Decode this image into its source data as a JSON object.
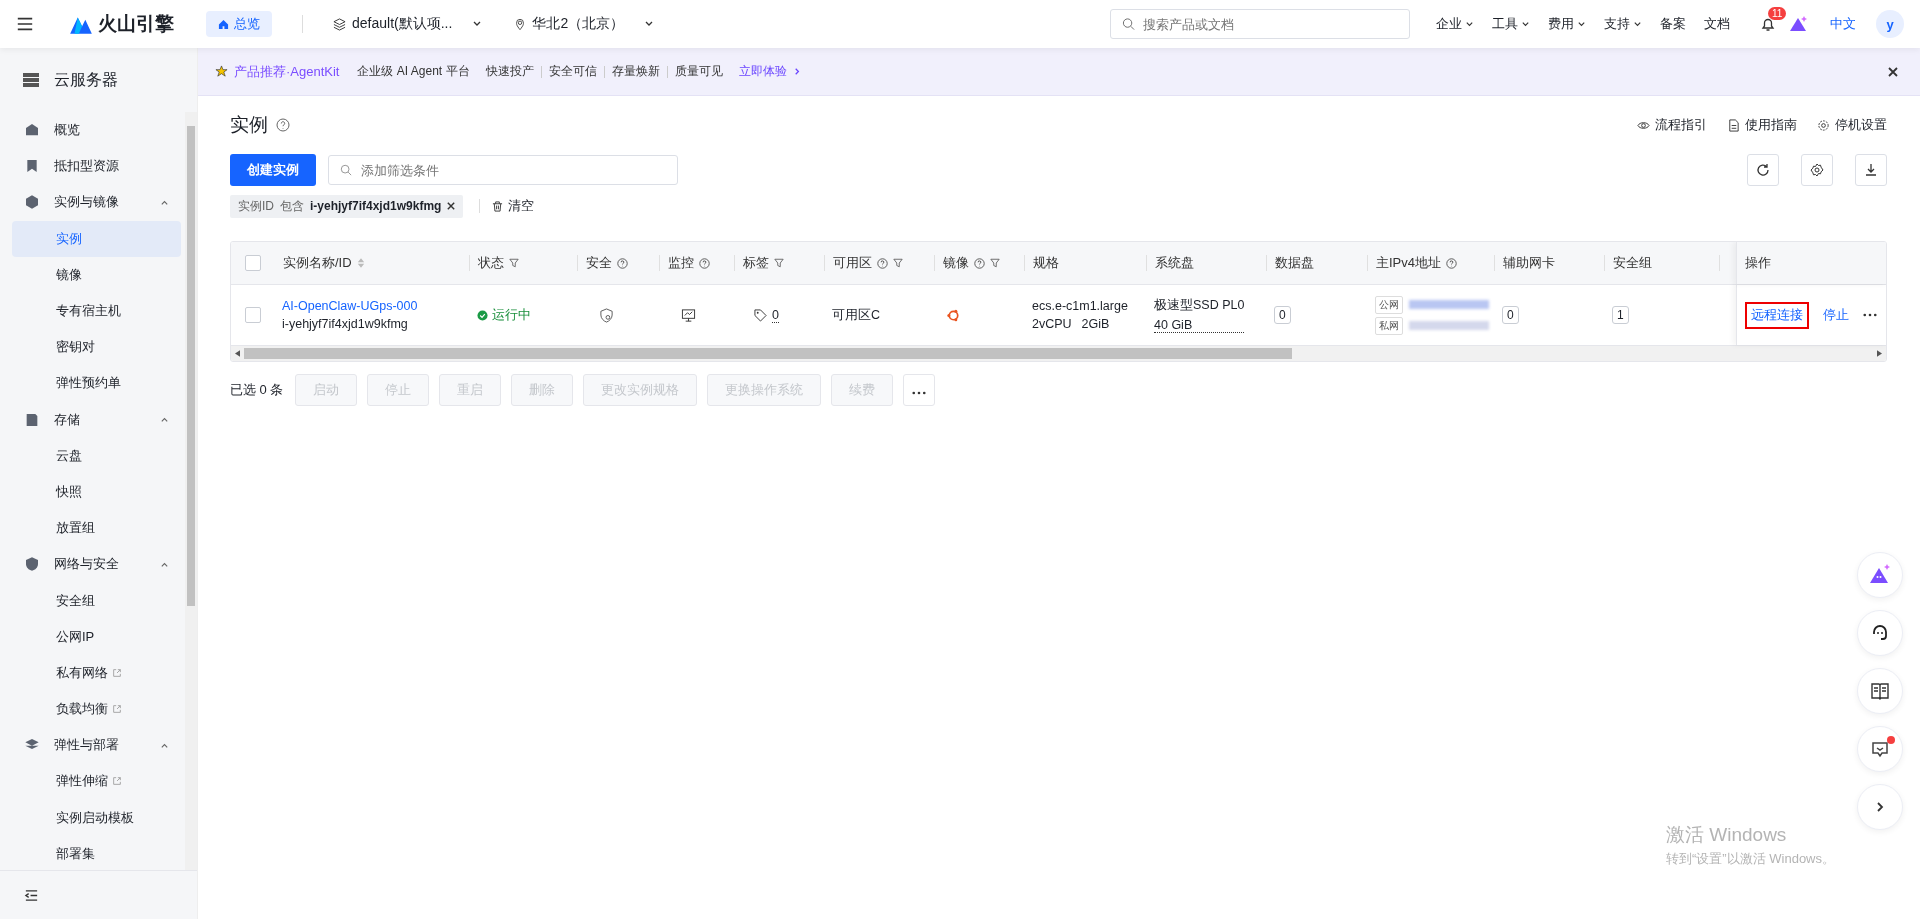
{
  "header": {
    "logo": "火山引擎",
    "home": {
      "label": "总览",
      "selected": true
    },
    "project": "default(默认项...",
    "region": "华北2（北京）",
    "search": {
      "placeholder": "搜索产品或文档"
    },
    "nav": [
      {
        "label": "企业",
        "dropdown": true
      },
      {
        "label": "工具",
        "dropdown": true
      },
      {
        "label": "费用",
        "dropdown": true
      },
      {
        "label": "支持",
        "dropdown": true
      },
      {
        "label": "备案"
      },
      {
        "label": "文档"
      }
    ],
    "notifications": "11",
    "language": "中文",
    "avatar": "y"
  },
  "sidebar": {
    "title": "云服务器",
    "items": [
      {
        "label": "概览"
      },
      {
        "label": "抵扣型资源"
      },
      {
        "label": "实例与镜像",
        "expanded": true,
        "children": [
          {
            "label": "实例",
            "selected": true
          },
          {
            "label": "镜像",
            "selected": false
          },
          {
            "label": "专有宿主机",
            "selected": false
          },
          {
            "label": "密钥对",
            "selected": false
          },
          {
            "label": "弹性预约单",
            "selected": false
          }
        ]
      },
      {
        "label": "存储",
        "expanded": true,
        "children": [
          {
            "label": "云盘",
            "selected": false
          },
          {
            "label": "快照",
            "selected": false
          },
          {
            "label": "放置组",
            "selected": false
          }
        ]
      },
      {
        "label": "网络与安全",
        "expanded": true,
        "children": [
          {
            "label": "安全组",
            "selected": false
          },
          {
            "label": "公网IP",
            "selected": false
          },
          {
            "label": "私有网络",
            "selected": false,
            "external": true
          },
          {
            "label": "负载均衡",
            "selected": false,
            "external": true
          }
        ]
      },
      {
        "label": "弹性与部署",
        "expanded": true,
        "children": [
          {
            "label": "弹性伸缩",
            "selected": false,
            "external": true
          },
          {
            "label": "实例启动模板",
            "selected": false
          },
          {
            "label": "部署集",
            "selected": false
          }
        ]
      }
    ]
  },
  "banner": {
    "title": "产品推荐·AgentKit",
    "subtitle": "企业级 AI Agent 平台",
    "features": [
      "快速投产",
      "安全可信",
      "存量焕新",
      "质量可见"
    ],
    "link": "立即体验"
  },
  "page": {
    "title": "实例",
    "links": [
      "流程指引",
      "使用指南",
      "停机设置"
    ],
    "create_button": "创建实例",
    "filter": {
      "placeholder": "添加筛选条件"
    },
    "filter_tag": {
      "key": "实例ID",
      "operator": "包含",
      "value": "i-yehjyf7if4xjd1w9kfmg"
    },
    "clear": "清空"
  },
  "table": {
    "select_all": {
      "checked": false
    },
    "columns": [
      {
        "label": "实例名称/ID",
        "sort": true
      },
      {
        "label": "状态",
        "filter": true
      },
      {
        "label": "安全",
        "help": true
      },
      {
        "label": "监控",
        "help": true
      },
      {
        "label": "标签",
        "filter": true
      },
      {
        "label": "可用区",
        "help": true,
        "filter": true
      },
      {
        "label": "镜像",
        "help": true,
        "filter": true
      },
      {
        "label": "规格"
      },
      {
        "label": "系统盘"
      },
      {
        "label": "数据盘"
      },
      {
        "label": "主IPv4地址",
        "help": true
      },
      {
        "label": "辅助网卡"
      },
      {
        "label": "安全组"
      }
    ],
    "actions_column": "操作",
    "rows": [
      {
        "checked": false,
        "name": "AI-OpenClaw-UGps-000",
        "id": "i-yehjyf7if4xjd1w9kfmg",
        "status": {
          "label": "运行中",
          "kind": "running"
        },
        "tags": "0",
        "zone": "可用区C",
        "spec": "ecs.e-c1m1.large",
        "cpu": "2vCPU",
        "memory": "2GiB",
        "system_disk": "极速型SSD PL0",
        "system_disk_size": "40 GiB",
        "data_disks": "0",
        "ip_labels": [
          "公网",
          "私网"
        ],
        "aux_nics": "0",
        "security_groups": "1",
        "actions": [
          {
            "label": "远程连接",
            "highlighted": true
          },
          {
            "label": "停止",
            "highlighted": false
          }
        ]
      }
    ]
  },
  "footer": {
    "selected_count": "已选 0 条",
    "buttons": [
      {
        "label": "启动",
        "disabled": true
      },
      {
        "label": "停止",
        "disabled": true
      },
      {
        "label": "重启",
        "disabled": true
      },
      {
        "label": "删除",
        "disabled": true
      },
      {
        "label": "更改实例规格",
        "disabled": true
      },
      {
        "label": "更换操作系统",
        "disabled": true
      },
      {
        "label": "续费",
        "disabled": true
      }
    ]
  },
  "floating": [
    {
      "kind": "ai",
      "dot": false
    },
    {
      "kind": "support",
      "dot": false
    },
    {
      "kind": "docs",
      "dot": false
    },
    {
      "kind": "feedback",
      "dot": true
    },
    {
      "kind": "expand",
      "dot": false
    }
  ],
  "os_notice": {
    "title": "激活 Windows",
    "text": "转到“设置”以激活 Windows。"
  }
}
